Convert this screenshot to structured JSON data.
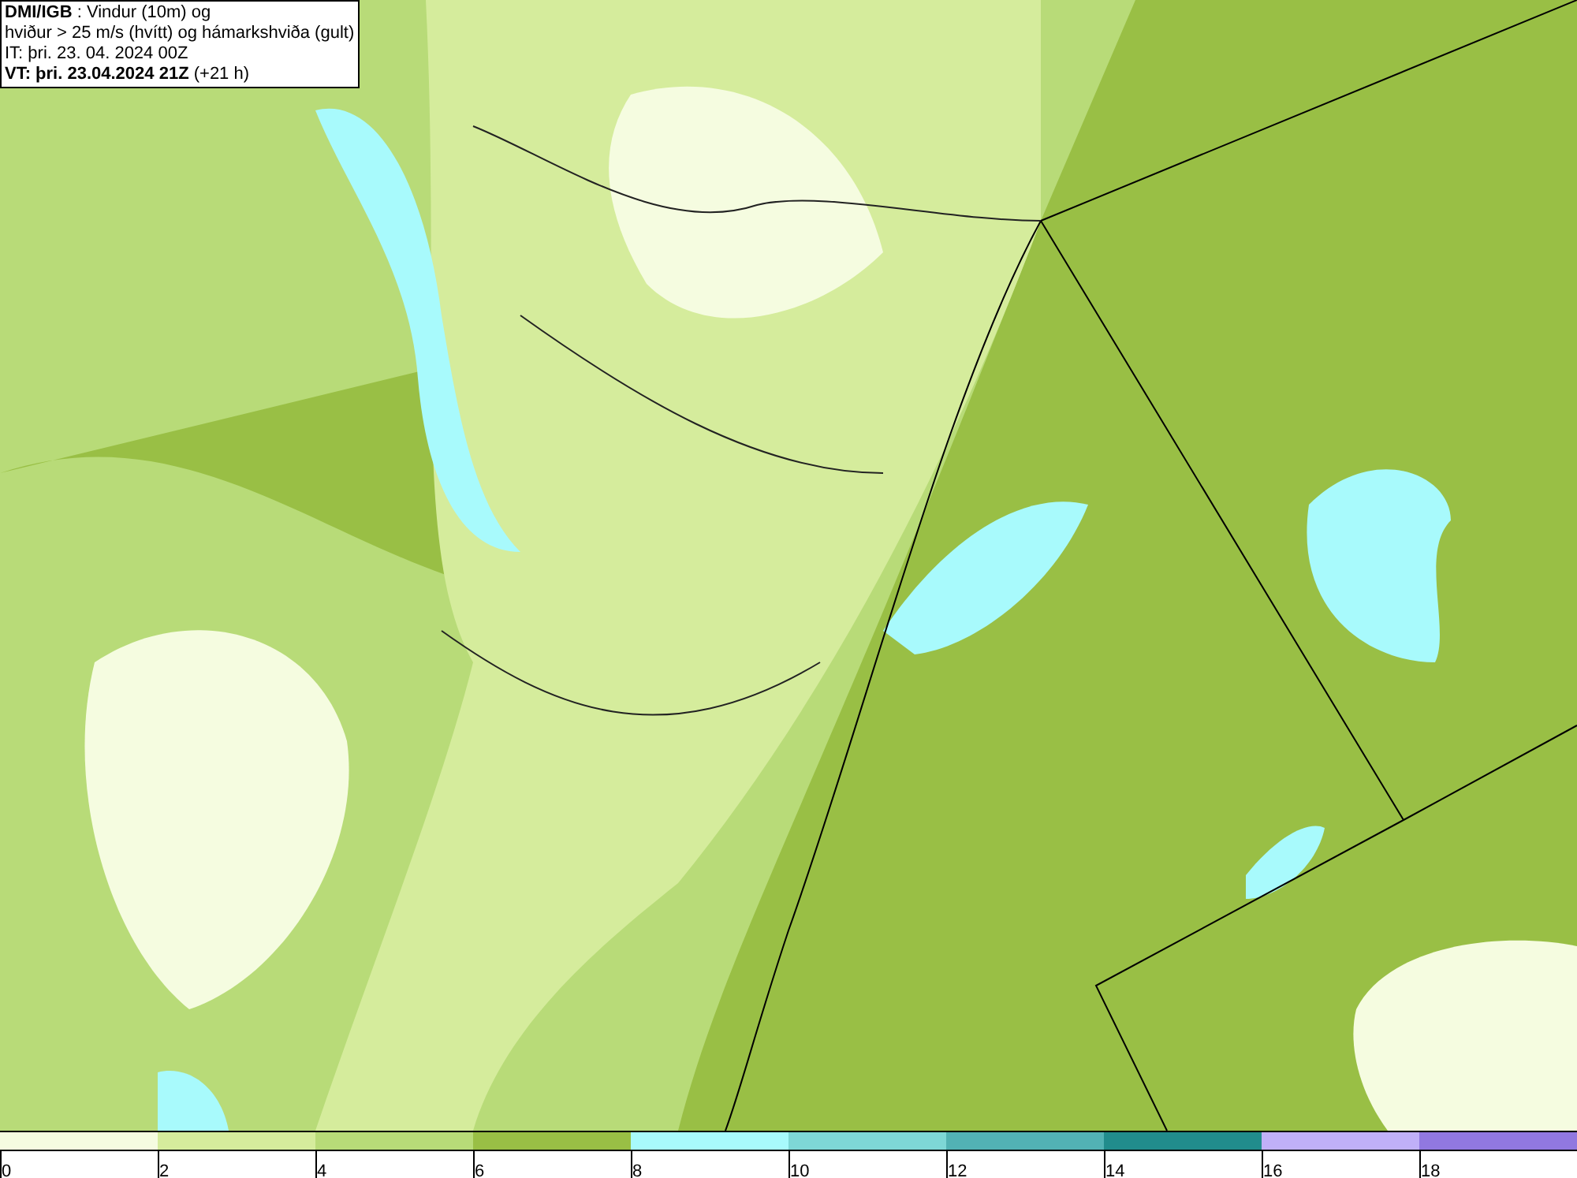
{
  "header": {
    "lines": [
      "**DMI/IGB** : Vindur (10m) og",
      "hviður > 25 m/s (hvítt) og hámarkshviða (gult)",
      "IT: þri. 23. 04. 2024 00Z",
      "**VT: þri. 23.04.2024 21Z** (+21 h)"
    ]
  },
  "legend": {
    "bins": [
      {
        "label": "0",
        "color": "#f5fce0"
      },
      {
        "label": "2",
        "color": "#d5ec9c"
      },
      {
        "label": "4",
        "color": "#b8db78"
      },
      {
        "label": "6",
        "color": "#99bf45"
      },
      {
        "label": "8",
        "color": "#a8fafc"
      },
      {
        "label": "10",
        "color": "#7ed7d6"
      },
      {
        "label": "12",
        "color": "#52b2b4"
      },
      {
        "label": "14",
        "color": "#218c8c"
      },
      {
        "label": "16",
        "color": "#c0b0f8"
      },
      {
        "label": "18",
        "color": "#9178e0"
      }
    ]
  }
}
